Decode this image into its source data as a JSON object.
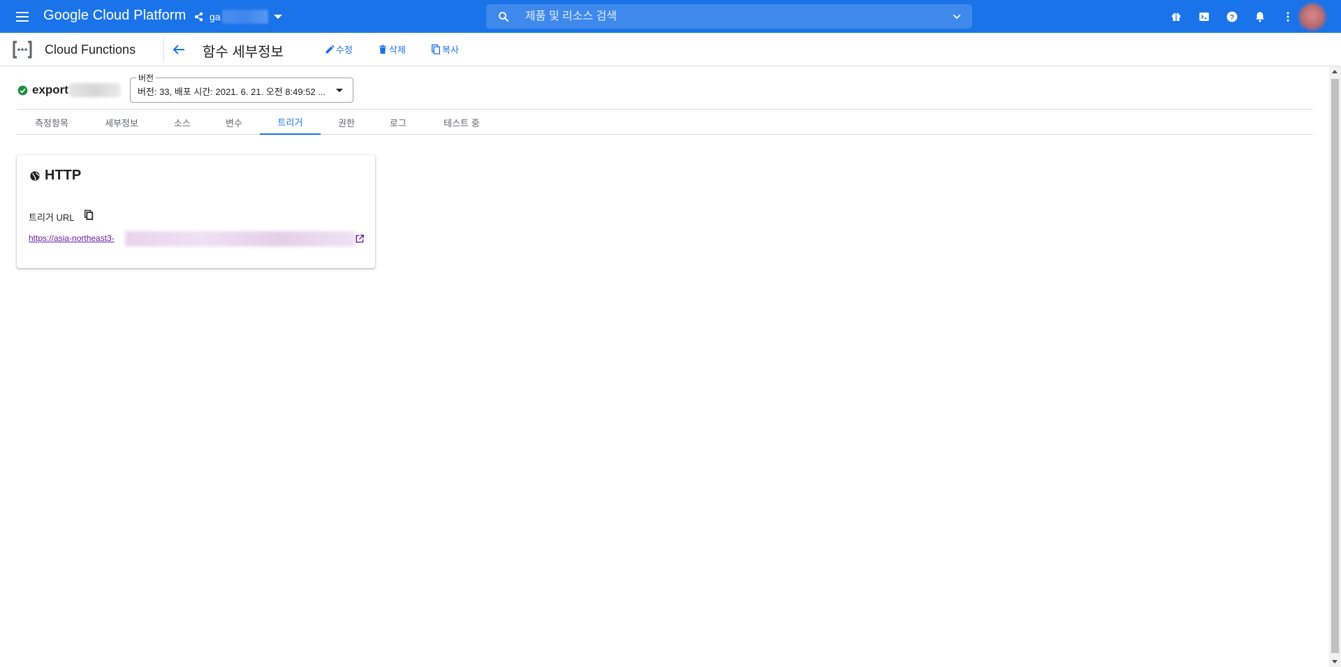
{
  "topbar": {
    "brand": "Google Cloud Platform",
    "project_name": "ga",
    "search_placeholder": "제품 및 리소스 검색",
    "icons": [
      "menu-icon",
      "project-icon",
      "search-icon",
      "gift-icon",
      "cloud-shell-icon",
      "help-icon",
      "notifications-icon",
      "more-vert-icon"
    ]
  },
  "subbar": {
    "product": "Cloud Functions",
    "page_title": "함수 세부정보",
    "actions": {
      "edit": "수정",
      "delete": "삭제",
      "copy": "복사"
    }
  },
  "function": {
    "name": "export",
    "status": "ok",
    "version_label": "버전",
    "version_value": "버전: 33, 배포 시간: 2021. 6. 21. 오전 8:49:52 ..."
  },
  "tabs": [
    {
      "label": "측정항목",
      "active": false
    },
    {
      "label": "세부정보",
      "active": false
    },
    {
      "label": "소스",
      "active": false
    },
    {
      "label": "변수",
      "active": false
    },
    {
      "label": "트리거",
      "active": true
    },
    {
      "label": "권한",
      "active": false
    },
    {
      "label": "로그",
      "active": false
    },
    {
      "label": "테스트 중",
      "active": false
    }
  ],
  "trigger_card": {
    "title": "HTTP",
    "url_label": "트리거 URL",
    "url": "https://asia-northeast3-"
  },
  "colors": {
    "topbar": "#1a73e8",
    "accent": "#1a73e8",
    "status_ok": "#1e8e3e",
    "link_visited": "#681da8"
  }
}
